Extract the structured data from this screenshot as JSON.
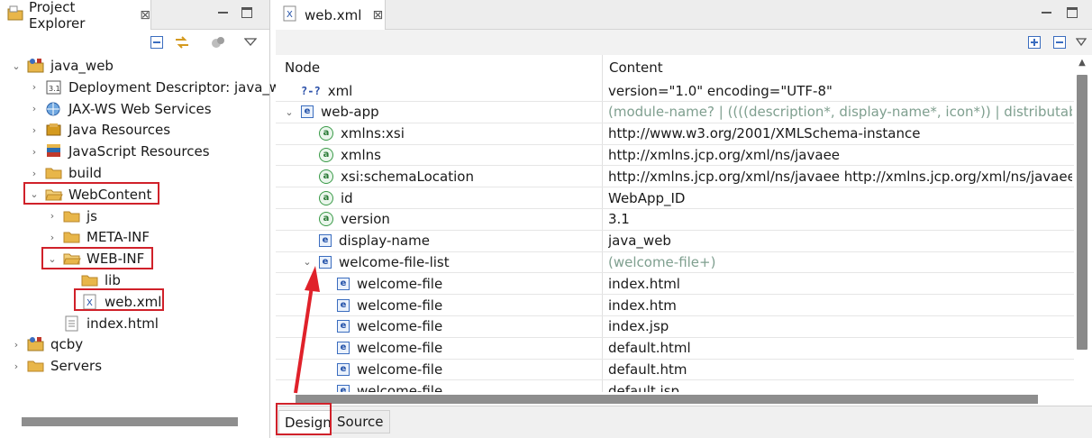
{
  "explorer": {
    "tab_title": "Project Explorer",
    "close_glyph": "⊠",
    "tree": [
      {
        "label": "java_web",
        "icon": "project-icon",
        "twisty": "⌄"
      },
      {
        "label": "Deployment Descriptor: java_w",
        "icon": "deployment-descriptor-icon",
        "twisty": "›"
      },
      {
        "label": "JAX-WS Web Services",
        "icon": "web-services-icon",
        "twisty": "›"
      },
      {
        "label": "Java Resources",
        "icon": "java-resources-icon",
        "twisty": "›"
      },
      {
        "label": "JavaScript Resources",
        "icon": "javascript-resources-icon",
        "twisty": "›"
      },
      {
        "label": "build",
        "icon": "folder-icon",
        "twisty": "›"
      },
      {
        "label": "WebContent",
        "icon": "folder-open-icon",
        "twisty": "⌄"
      },
      {
        "label": "js",
        "icon": "folder-icon",
        "twisty": "›"
      },
      {
        "label": "META-INF",
        "icon": "folder-icon",
        "twisty": "›"
      },
      {
        "label": "WEB-INF",
        "icon": "folder-open-icon",
        "twisty": "⌄"
      },
      {
        "label": "lib",
        "icon": "folder-icon",
        "twisty": ""
      },
      {
        "label": "web.xml",
        "icon": "xml-file-icon",
        "twisty": ""
      },
      {
        "label": "index.html",
        "icon": "html-file-icon",
        "twisty": ""
      },
      {
        "label": "qcby",
        "icon": "project-icon",
        "twisty": "›"
      },
      {
        "label": "Servers",
        "icon": "folder-icon",
        "twisty": "›"
      }
    ]
  },
  "editor": {
    "tab_title": "web.xml",
    "close_glyph": "⊠",
    "columns": {
      "node": "Node",
      "content": "Content"
    },
    "rows": [
      {
        "node": "xml",
        "icon": "processing-instruction-icon",
        "twisty": "",
        "content": "version=\"1.0\" encoding=\"UTF-8\"",
        "gray": false
      },
      {
        "node": "web-app",
        "icon": "element-icon",
        "twisty": "⌄",
        "content": "(module-name? | ((((description*, display-name*, icon*)) | distributable | cont",
        "gray": true
      },
      {
        "node": "xmlns:xsi",
        "icon": "attribute-icon",
        "twisty": "",
        "content": "http://www.w3.org/2001/XMLSchema-instance",
        "gray": false
      },
      {
        "node": "xmlns",
        "icon": "attribute-icon",
        "twisty": "",
        "content": "http://xmlns.jcp.org/xml/ns/javaee",
        "gray": false
      },
      {
        "node": "xsi:schemaLocation",
        "icon": "attribute-icon",
        "twisty": "",
        "content": "http://xmlns.jcp.org/xml/ns/javaee http://xmlns.jcp.org/xml/ns/javaee/web-",
        "gray": false
      },
      {
        "node": "id",
        "icon": "attribute-icon",
        "twisty": "",
        "content": "WebApp_ID",
        "gray": false
      },
      {
        "node": "version",
        "icon": "attribute-icon",
        "twisty": "",
        "content": "3.1",
        "gray": false
      },
      {
        "node": "display-name",
        "icon": "element-icon",
        "twisty": "",
        "content": "java_web",
        "gray": false
      },
      {
        "node": "welcome-file-list",
        "icon": "element-icon",
        "twisty": "⌄",
        "content": "(welcome-file+)",
        "gray": true
      },
      {
        "node": "welcome-file",
        "icon": "element-icon",
        "twisty": "",
        "content": "index.html",
        "gray": false
      },
      {
        "node": "welcome-file",
        "icon": "element-icon",
        "twisty": "",
        "content": "index.htm",
        "gray": false
      },
      {
        "node": "welcome-file",
        "icon": "element-icon",
        "twisty": "",
        "content": "index.jsp",
        "gray": false
      },
      {
        "node": "welcome-file",
        "icon": "element-icon",
        "twisty": "",
        "content": "default.html",
        "gray": false
      },
      {
        "node": "welcome-file",
        "icon": "element-icon",
        "twisty": "",
        "content": "default.htm",
        "gray": false
      },
      {
        "node": "welcome-file",
        "icon": "element-icon",
        "twisty": "",
        "content": "default.jsp",
        "gray": false
      }
    ],
    "bottom_tabs": [
      {
        "label": "Design",
        "active": true
      },
      {
        "label": "Source",
        "active": false
      }
    ]
  },
  "colors": {
    "highlight": "#d0212a",
    "folder": "#e8b64a",
    "element": "#3b6dbf",
    "attribute": "#3a9a48",
    "grayed_text": "#7f9f8f"
  }
}
